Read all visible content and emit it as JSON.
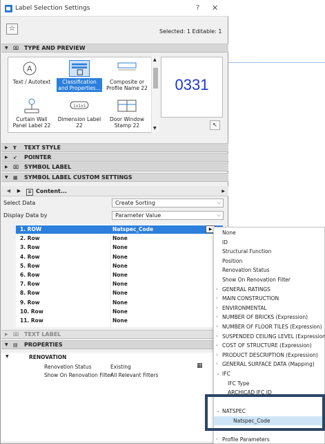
{
  "window": {
    "title": "Label Selection Settings",
    "help": "?",
    "close": "✕"
  },
  "toolbar": {
    "favorites_icon": "star-icon",
    "selection_info": "Selected: 1 Editable: 1"
  },
  "sections": {
    "type_preview": "TYPE AND PREVIEW",
    "text_style": "TEXT STYLE",
    "pointer": "POINTER",
    "symbol_label": "SYMBOL LABEL",
    "symbol_custom": "SYMBOL LABEL CUSTOM SETTINGS",
    "text_label": "TEXT LABEL",
    "properties": "PROPERTIES"
  },
  "gallery": [
    {
      "label": "Text / Autotext",
      "selected": false
    },
    {
      "label": "Classification and Properties...",
      "selected": true
    },
    {
      "label": "Composite or Profile Name 22",
      "selected": false
    },
    {
      "label": "Curtain Wall Panel Label 22",
      "selected": false
    },
    {
      "label": "Dimension Label 22",
      "selected": false
    },
    {
      "label": "Door Window Stamp 22",
      "selected": false
    }
  ],
  "preview": {
    "text": "0331",
    "text_color": "#1e36c8"
  },
  "nav": {
    "content_label": "Content..."
  },
  "select_data": {
    "label": "Select Data",
    "value": "Create Sorting"
  },
  "display_data": {
    "label": "Display Data by",
    "value": "Parameter Value"
  },
  "rows": [
    {
      "name": "1. ROW",
      "value": "Natspec_Code",
      "selected": true
    },
    {
      "name": "2. Row",
      "value": "None"
    },
    {
      "name": "3. Row",
      "value": "None"
    },
    {
      "name": "4. Row",
      "value": "None"
    },
    {
      "name": "5. Row",
      "value": "None"
    },
    {
      "name": "6. Row",
      "value": "None"
    },
    {
      "name": "7. Row",
      "value": "None"
    },
    {
      "name": "8. Row",
      "value": "None"
    },
    {
      "name": "9. Row",
      "value": "None"
    },
    {
      "name": "10. Row",
      "value": "None"
    },
    {
      "name": "11. Row",
      "value": "None"
    }
  ],
  "properties": {
    "group": "RENOVATION",
    "items": [
      {
        "name": "Renovation Status",
        "value": "Existing"
      },
      {
        "name": "Show On Renovation Filter",
        "value": "All Relevant Filters"
      }
    ]
  },
  "popup": [
    {
      "label": "None",
      "level": 0
    },
    {
      "label": "ID",
      "level": 0
    },
    {
      "label": "Structural Function",
      "level": 0
    },
    {
      "label": "Position",
      "level": 0
    },
    {
      "label": "Renovation Status",
      "level": 0
    },
    {
      "label": "Show On Renovation Filter",
      "level": 0
    },
    {
      "label": "GENERAL RATINGS",
      "level": 0,
      "chev": ">"
    },
    {
      "label": "MAIN CONSTRUCTION",
      "level": 0,
      "chev": ">"
    },
    {
      "label": "ENVIRONMENTAL",
      "level": 0,
      "chev": ">"
    },
    {
      "label": "NUMBER OF BRICKS (Expression)",
      "level": 0,
      "chev": ">"
    },
    {
      "label": "NUMBER OF FLOOR TILES (Expression)",
      "level": 0,
      "chev": ">"
    },
    {
      "label": "SUSPENDED CEILING LEVEL (Expression)",
      "level": 0,
      "chev": ">"
    },
    {
      "label": "COST OF STRUCTURE (Expression)",
      "level": 0,
      "chev": ">"
    },
    {
      "label": "PRODUCT DESCRIPTION (Expression)",
      "level": 0,
      "chev": ">"
    },
    {
      "label": "GENERAL SURFACE DATA (Mapping)",
      "level": 0,
      "chev": ">"
    },
    {
      "label": "IFC",
      "level": 0,
      "chev": "v"
    },
    {
      "label": "IFC Type",
      "level": 1
    },
    {
      "label": "ARCHICAD IFC ID",
      "level": 1
    },
    {
      "label": "",
      "level": 1
    },
    {
      "label": "NATSPEC",
      "level": 0,
      "chev": "v"
    },
    {
      "label": "Natspec_Code",
      "level": 2,
      "selected": true
    },
    {
      "label": "",
      "level": 1
    },
    {
      "label": "Profile Parameters",
      "level": 0,
      "chev": ">"
    }
  ],
  "colors": {
    "accent": "#2c7fdc",
    "highlight_frame": "#2b4566",
    "popup_selected": "#cde5f7"
  }
}
